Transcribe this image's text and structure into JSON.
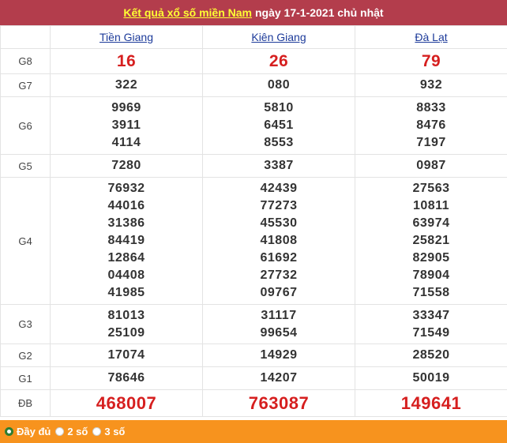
{
  "header": {
    "link_text": "Kết quả xổ số miền Nam",
    "rest_text": "ngày 17-1-2021 chủ nhật"
  },
  "provinces": [
    "Tiền Giang",
    "Kiên Giang",
    "Đà Lạt"
  ],
  "rows": [
    {
      "label": "G8",
      "values": [
        [
          "16"
        ],
        [
          "26"
        ],
        [
          "79"
        ]
      ]
    },
    {
      "label": "G7",
      "values": [
        [
          "322"
        ],
        [
          "080"
        ],
        [
          "932"
        ]
      ]
    },
    {
      "label": "G6",
      "values": [
        [
          "9969",
          "3911",
          "4114"
        ],
        [
          "5810",
          "6451",
          "8553"
        ],
        [
          "8833",
          "8476",
          "7197"
        ]
      ]
    },
    {
      "label": "G5",
      "values": [
        [
          "7280"
        ],
        [
          "3387"
        ],
        [
          "0987"
        ]
      ]
    },
    {
      "label": "G4",
      "values": [
        [
          "76932",
          "44016",
          "31386",
          "84419",
          "12864",
          "04408",
          "41985"
        ],
        [
          "42439",
          "77273",
          "45530",
          "41808",
          "61692",
          "27732",
          "09767"
        ],
        [
          "27563",
          "10811",
          "63974",
          "25821",
          "82905",
          "78904",
          "71558"
        ]
      ]
    },
    {
      "label": "G3",
      "values": [
        [
          "81013",
          "25109"
        ],
        [
          "31117",
          "99654"
        ],
        [
          "33347",
          "71549"
        ]
      ]
    },
    {
      "label": "G2",
      "values": [
        [
          "17074"
        ],
        [
          "14929"
        ],
        [
          "28520"
        ]
      ]
    },
    {
      "label": "G1",
      "values": [
        [
          "78646"
        ],
        [
          "14207"
        ],
        [
          "50019"
        ]
      ]
    },
    {
      "label": "ĐB",
      "values": [
        [
          "468007"
        ],
        [
          "763087"
        ],
        [
          "149641"
        ]
      ]
    }
  ],
  "footer": {
    "options": [
      {
        "label": "Đầy đủ",
        "selected": true
      },
      {
        "label": "2 số",
        "selected": false
      },
      {
        "label": "3 số",
        "selected": false
      }
    ]
  },
  "colors": {
    "header_bg": "#b33d4c",
    "header_link": "#ffff33",
    "province_link": "#1d3b9a",
    "prize_red": "#d61f1f",
    "footer_bg": "#f7931e"
  }
}
